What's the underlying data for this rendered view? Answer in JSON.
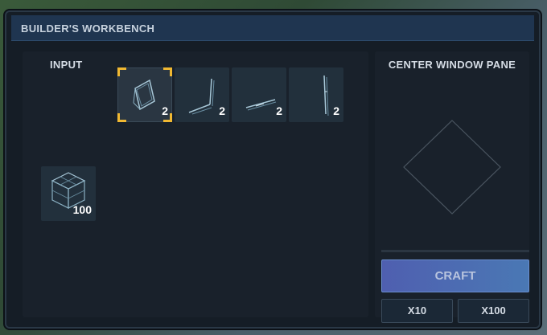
{
  "window": {
    "title": "BUILDER'S WORKBENCH"
  },
  "input": {
    "label": "INPUT",
    "source_slot": {
      "icon": "building-block-icon",
      "count": "100"
    }
  },
  "outputs": [
    {
      "icon": "window-pane-icon",
      "count": "2",
      "selected": true
    },
    {
      "icon": "window-frame-corner-icon",
      "count": "2",
      "selected": false
    },
    {
      "icon": "window-sill-icon",
      "count": "2",
      "selected": false
    },
    {
      "icon": "window-frame-vertical-icon",
      "count": "2",
      "selected": false
    }
  ],
  "preview": {
    "title": "CENTER WINDOW PANE",
    "icon": "diamond-outline-icon"
  },
  "actions": {
    "craft_label": "CRAFT",
    "x10_label": "X10",
    "x100_label": "X100"
  },
  "colors": {
    "title_bar": "#1f3550",
    "selection_accent": "#f0b832",
    "craft_button_start": "#4f5fb0",
    "craft_button_end": "#4a78b4"
  }
}
